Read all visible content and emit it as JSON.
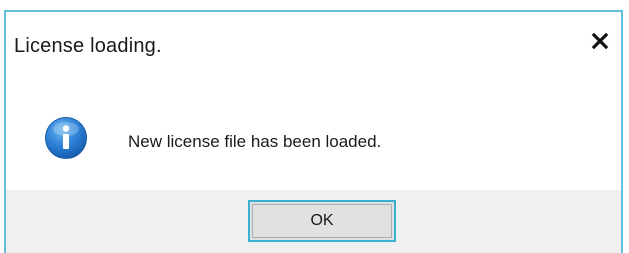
{
  "dialog": {
    "title": "License loading.",
    "message": "New license file has been loaded.",
    "ok_label": "OK",
    "close_icon": "close-icon",
    "info_icon": "info-icon"
  },
  "colors": {
    "border_accent": "#5fc2da",
    "button_focus_border": "#3ab1d0",
    "info_icon_blue": "#1e73c8",
    "footer_bg": "#f0f0f0"
  }
}
